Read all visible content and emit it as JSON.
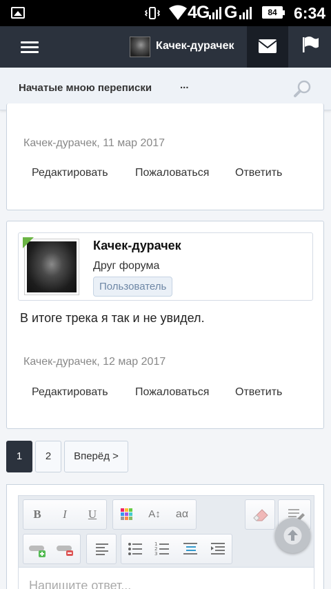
{
  "statusbar": {
    "network1": "4G",
    "network2": "G",
    "battery": "84",
    "time": "6:34"
  },
  "header": {
    "site_title": "Качек-дурачек"
  },
  "subnav": {
    "conversations_label": "Начатые мною переписки",
    "more_label": "..."
  },
  "posts": [
    {
      "meta": "Качек-дурачек, 11 мар 2017",
      "actions": {
        "edit": "Редактировать",
        "report": "Пожаловаться",
        "reply": "Ответить"
      }
    },
    {
      "author": "Качек-дурачек",
      "user_title": "Друг форума",
      "user_badge": "Пользователь",
      "message": "В итоге трека я так и не увидел.",
      "meta": "Качек-дурачек, 12 мар 2017",
      "actions": {
        "edit": "Редактировать",
        "report": "Пожаловаться",
        "reply": "Ответить"
      }
    }
  ],
  "pagination": {
    "pages": [
      "1",
      "2"
    ],
    "next_label": "Вперёд >"
  },
  "editor": {
    "placeholder": "Напишите ответ..."
  },
  "colors": {
    "header_bg": "#2b323d",
    "online_indicator": "#6bb544",
    "badge_text": "#6e87a6"
  }
}
